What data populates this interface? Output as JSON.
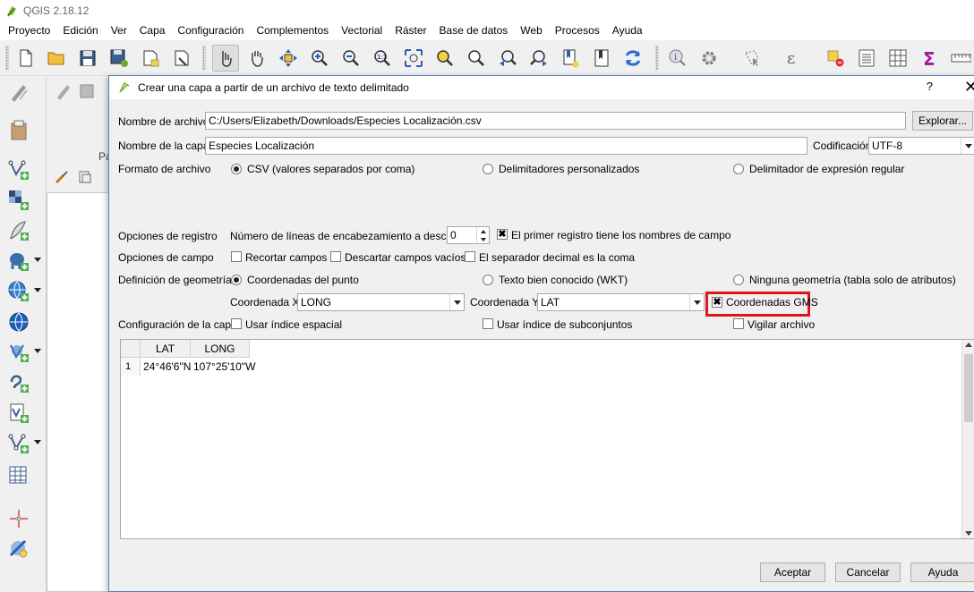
{
  "app": {
    "title": "QGIS 2.18.12"
  },
  "menu": [
    "Proyecto",
    "Edición",
    "Ver",
    "Capa",
    "Configuración",
    "Complementos",
    "Vectorial",
    "Ráster",
    "Base de datos",
    "Web",
    "Procesos",
    "Ayuda"
  ],
  "layer_panel": {
    "partial_label": "Pa"
  },
  "dialog": {
    "title": "Crear una capa a partir de un archivo de texto delimitado",
    "help": "?",
    "close": "✕",
    "file_name": {
      "label": "Nombre de archivo",
      "value": "C:/Users/Elizabeth/Downloads/Especies Localización.csv",
      "browse_label": "Explorar..."
    },
    "layer_name": {
      "label": "Nombre de la capa",
      "value": "Especies Localización"
    },
    "encoding": {
      "label": "Codificación",
      "value": "UTF-8"
    },
    "file_format": {
      "label": "Formato de archivo",
      "options": [
        "CSV (valores separados por coma)",
        "Delimitadores personalizados",
        "Delimitador de expresión regular"
      ],
      "selected": 0
    },
    "record_options": {
      "label": "Opciones de registro",
      "skip_lines_label": "Número de líneas de encabezamiento a descartar",
      "skip_lines_value": "0",
      "first_record_label": "El primer registro tiene los nombres de campo",
      "first_record_checked": true
    },
    "field_options": {
      "label": "Opciones de campo",
      "trim_label": "Recortar campos",
      "discard_empty_label": "Descartar campos vacíos",
      "decimal_comma_label": "El separador decimal es la coma"
    },
    "geometry": {
      "label": "Definición de geometría",
      "options": [
        "Coordenadas del punto",
        "Texto bien conocido (WKT)",
        "Ninguna geometría (tabla solo de atributos)"
      ],
      "selected": 0,
      "x_label": "Coordenada X",
      "x_value": "LONG",
      "y_label": "Coordenada Y",
      "y_value": "LAT",
      "dms_label": "Coordenadas GMS",
      "dms_checked": true
    },
    "layer_settings": {
      "label": "Configuración de la capa",
      "spatial_index_label": "Usar índice espacial",
      "subset_index_label": "Usar índice de subconjuntos",
      "watch_file_label": "Vigilar archivo"
    },
    "preview": {
      "columns": [
        "LAT",
        "LONG"
      ],
      "rows": [
        {
          "num": "1",
          "cells": [
            "24°46'6\"N",
            "107°25'10\"W"
          ]
        }
      ]
    },
    "buttons": {
      "ok": "Aceptar",
      "cancel": "Cancelar",
      "help": "Ayuda"
    }
  },
  "colors": {
    "highlight": "#e0141e",
    "dialog_border": "#5a7fb0"
  }
}
